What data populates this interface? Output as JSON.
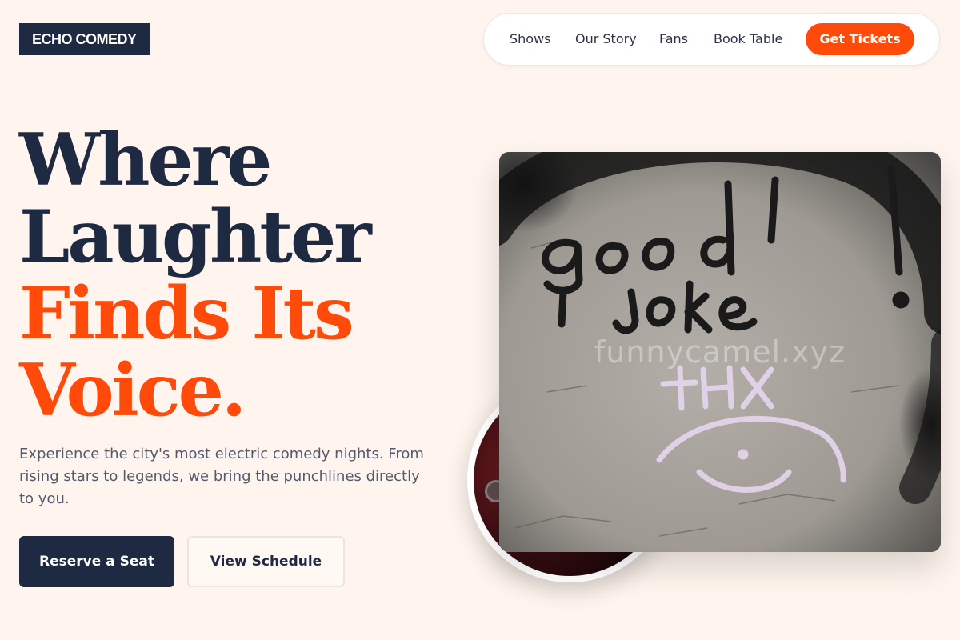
{
  "brand": {
    "logo_text": "ECHO COMEDY"
  },
  "nav": {
    "links": [
      "Shows",
      "Our Story",
      "Fans",
      "Book Table"
    ],
    "cta_label": "Get Tickets"
  },
  "hero": {
    "title_lines": [
      "Where",
      "Laughter",
      "Finds Its",
      "Voice."
    ],
    "subtitle": "Experience the city's most electric comedy nights. From rising stars to legends, we bring the punchlines directly to you.",
    "primary_button": "Reserve a Seat",
    "secondary_button": "View Schedule"
  },
  "media": {
    "main_photo_watermark": "funnycamel.xyz",
    "graffiti_text": [
      "good",
      "joke",
      "!",
      "+HX"
    ]
  },
  "colors": {
    "background": "#fff5ee",
    "navy": "#1e2a42",
    "accent": "#ff4a0a"
  }
}
